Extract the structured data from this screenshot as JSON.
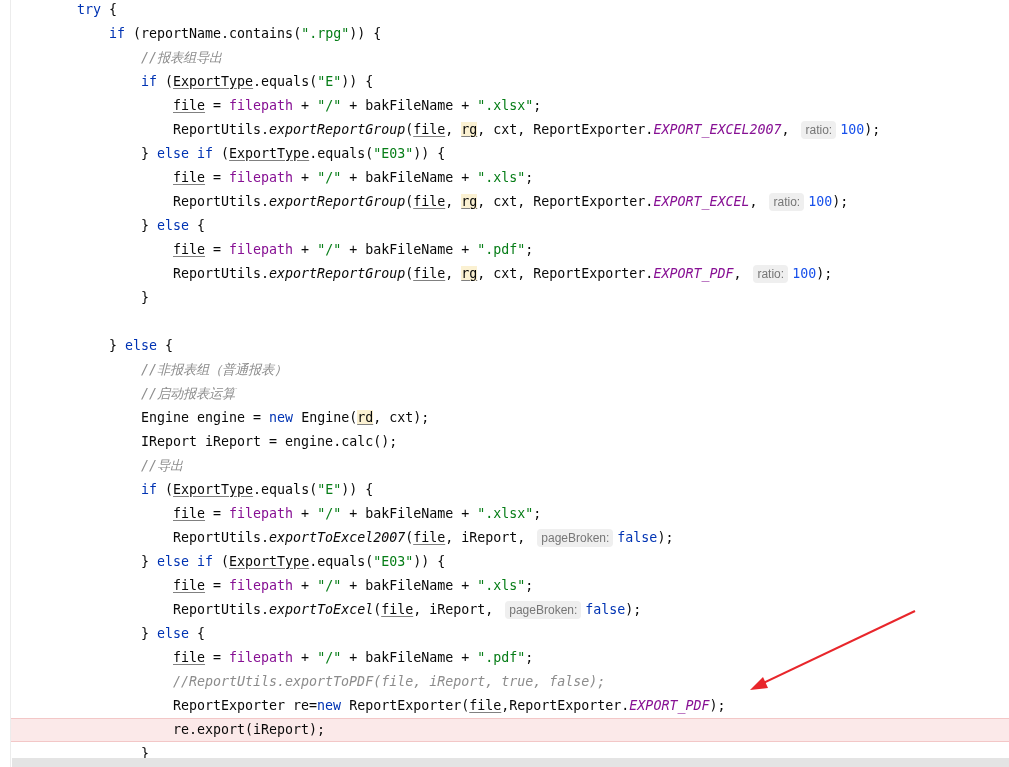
{
  "editor": {
    "lines": [
      {
        "tokens": [
          {
            "kind": "keyword",
            "text": "try"
          },
          {
            "kind": "plain",
            "text": " {"
          }
        ],
        "children": [
          {
            "tokens": [
              {
                "kind": "keyword",
                "text": "if"
              },
              {
                "kind": "plain",
                "text": " (reportName.contains("
              },
              {
                "kind": "string",
                "text": "\".rpg\""
              },
              {
                "kind": "plain",
                "text": ")) {"
              }
            ],
            "children": [
              {
                "tokens": [
                  {
                    "kind": "comment",
                    "text": "//报表组导出"
                  }
                ]
              },
              {
                "tokens": [
                  {
                    "kind": "keyword",
                    "text": "if"
                  },
                  {
                    "kind": "plain",
                    "text": " ("
                  },
                  {
                    "kind": "underlined",
                    "text": "ExportType"
                  },
                  {
                    "kind": "plain",
                    "text": ".equals("
                  },
                  {
                    "kind": "string",
                    "text": "\"E\""
                  },
                  {
                    "kind": "plain",
                    "text": ")) {"
                  }
                ],
                "children": [
                  {
                    "tokens": [
                      {
                        "kind": "underlined",
                        "text": "file"
                      },
                      {
                        "kind": "plain",
                        "text": " = "
                      },
                      {
                        "kind": "field",
                        "text": "filepath"
                      },
                      {
                        "kind": "plain",
                        "text": " + "
                      },
                      {
                        "kind": "string",
                        "text": "\"/\""
                      },
                      {
                        "kind": "plain",
                        "text": " + bakFileName + "
                      },
                      {
                        "kind": "string",
                        "text": "\".xlsx\""
                      },
                      {
                        "kind": "plain",
                        "text": ";"
                      }
                    ]
                  },
                  {
                    "tokens": [
                      {
                        "kind": "plain",
                        "text": "ReportUtils."
                      },
                      {
                        "kind": "method",
                        "text": "exportReportGroup"
                      },
                      {
                        "kind": "plain",
                        "text": "("
                      },
                      {
                        "kind": "underlined",
                        "text": "file"
                      },
                      {
                        "kind": "plain",
                        "text": ", "
                      },
                      {
                        "kind": "marked",
                        "text": "rg"
                      },
                      {
                        "kind": "plain",
                        "text": ", cxt, ReportExporter."
                      },
                      {
                        "kind": "constant",
                        "text": "EXPORT_EXCEL2007"
                      },
                      {
                        "kind": "plain",
                        "text": ", "
                      },
                      {
                        "kind": "hint",
                        "text": "ratio:"
                      },
                      {
                        "kind": "number",
                        "text": "100"
                      },
                      {
                        "kind": "plain",
                        "text": ");"
                      }
                    ]
                  }
                ]
              },
              {
                "tokens": [
                  {
                    "kind": "plain",
                    "text": "} "
                  },
                  {
                    "kind": "keyword",
                    "text": "else if"
                  },
                  {
                    "kind": "plain",
                    "text": " ("
                  },
                  {
                    "kind": "underlined",
                    "text": "ExportType"
                  },
                  {
                    "kind": "plain",
                    "text": ".equals("
                  },
                  {
                    "kind": "string",
                    "text": "\"E03\""
                  },
                  {
                    "kind": "plain",
                    "text": ")) {"
                  }
                ],
                "children": [
                  {
                    "tokens": [
                      {
                        "kind": "underlined",
                        "text": "file"
                      },
                      {
                        "kind": "plain",
                        "text": " = "
                      },
                      {
                        "kind": "field",
                        "text": "filepath"
                      },
                      {
                        "kind": "plain",
                        "text": " + "
                      },
                      {
                        "kind": "string",
                        "text": "\"/\""
                      },
                      {
                        "kind": "plain",
                        "text": " + bakFileName + "
                      },
                      {
                        "kind": "string",
                        "text": "\".xls\""
                      },
                      {
                        "kind": "plain",
                        "text": ";"
                      }
                    ]
                  },
                  {
                    "tokens": [
                      {
                        "kind": "plain",
                        "text": "ReportUtils."
                      },
                      {
                        "kind": "method",
                        "text": "exportReportGroup"
                      },
                      {
                        "kind": "plain",
                        "text": "("
                      },
                      {
                        "kind": "underlined",
                        "text": "file"
                      },
                      {
                        "kind": "plain",
                        "text": ", "
                      },
                      {
                        "kind": "marked",
                        "text": "rg"
                      },
                      {
                        "kind": "plain",
                        "text": ", cxt, ReportExporter."
                      },
                      {
                        "kind": "constant",
                        "text": "EXPORT_EXCEL"
                      },
                      {
                        "kind": "plain",
                        "text": ", "
                      },
                      {
                        "kind": "hint",
                        "text": "ratio:"
                      },
                      {
                        "kind": "number",
                        "text": "100"
                      },
                      {
                        "kind": "plain",
                        "text": ");"
                      }
                    ]
                  }
                ]
              },
              {
                "tokens": [
                  {
                    "kind": "plain",
                    "text": "} "
                  },
                  {
                    "kind": "keyword",
                    "text": "else"
                  },
                  {
                    "kind": "plain",
                    "text": " {"
                  }
                ],
                "children": [
                  {
                    "tokens": [
                      {
                        "kind": "underlined",
                        "text": "file"
                      },
                      {
                        "kind": "plain",
                        "text": " = "
                      },
                      {
                        "kind": "field",
                        "text": "filepath"
                      },
                      {
                        "kind": "plain",
                        "text": " + "
                      },
                      {
                        "kind": "string",
                        "text": "\"/\""
                      },
                      {
                        "kind": "plain",
                        "text": " + bakFileName + "
                      },
                      {
                        "kind": "string",
                        "text": "\".pdf\""
                      },
                      {
                        "kind": "plain",
                        "text": ";"
                      }
                    ]
                  },
                  {
                    "tokens": [
                      {
                        "kind": "plain",
                        "text": "ReportUtils."
                      },
                      {
                        "kind": "method",
                        "text": "exportReportGroup"
                      },
                      {
                        "kind": "plain",
                        "text": "("
                      },
                      {
                        "kind": "underlined",
                        "text": "file"
                      },
                      {
                        "kind": "plain",
                        "text": ", "
                      },
                      {
                        "kind": "marked",
                        "text": "rg"
                      },
                      {
                        "kind": "plain",
                        "text": ", cxt, ReportExporter."
                      },
                      {
                        "kind": "constant",
                        "text": "EXPORT_PDF"
                      },
                      {
                        "kind": "plain",
                        "text": ", "
                      },
                      {
                        "kind": "hint",
                        "text": "ratio:"
                      },
                      {
                        "kind": "number",
                        "text": "100"
                      },
                      {
                        "kind": "plain",
                        "text": ");"
                      }
                    ]
                  }
                ]
              },
              {
                "tokens": [
                  {
                    "kind": "plain",
                    "text": "}"
                  }
                ],
                "blank_line_after": true
              }
            ]
          },
          {
            "tokens": [
              {
                "kind": "plain",
                "text": "} "
              },
              {
                "kind": "keyword",
                "text": "else"
              },
              {
                "kind": "plain",
                "text": " {"
              }
            ],
            "children": [
              {
                "tokens": [
                  {
                    "kind": "comment",
                    "text": "//非报表组（普通报表）"
                  }
                ]
              },
              {
                "tokens": [
                  {
                    "kind": "comment",
                    "text": "//启动报表运算"
                  }
                ]
              },
              {
                "tokens": [
                  {
                    "kind": "plain",
                    "text": "Engine engine = "
                  },
                  {
                    "kind": "keyword",
                    "text": "new"
                  },
                  {
                    "kind": "plain",
                    "text": " Engine("
                  },
                  {
                    "kind": "marked",
                    "text": "rd"
                  },
                  {
                    "kind": "plain",
                    "text": ", cxt);"
                  }
                ]
              },
              {
                "tokens": [
                  {
                    "kind": "plain",
                    "text": "IReport iReport = engine.calc();"
                  }
                ]
              },
              {
                "tokens": [
                  {
                    "kind": "comment",
                    "text": "//导出"
                  }
                ]
              },
              {
                "tokens": [
                  {
                    "kind": "keyword",
                    "text": "if"
                  },
                  {
                    "kind": "plain",
                    "text": " ("
                  },
                  {
                    "kind": "underlined",
                    "text": "ExportType"
                  },
                  {
                    "kind": "plain",
                    "text": ".equals("
                  },
                  {
                    "kind": "string",
                    "text": "\"E\""
                  },
                  {
                    "kind": "plain",
                    "text": ")) {"
                  }
                ],
                "children": [
                  {
                    "tokens": [
                      {
                        "kind": "underlined",
                        "text": "file"
                      },
                      {
                        "kind": "plain",
                        "text": " = "
                      },
                      {
                        "kind": "field",
                        "text": "filepath"
                      },
                      {
                        "kind": "plain",
                        "text": " + "
                      },
                      {
                        "kind": "string",
                        "text": "\"/\""
                      },
                      {
                        "kind": "plain",
                        "text": " + bakFileName + "
                      },
                      {
                        "kind": "string",
                        "text": "\".xlsx\""
                      },
                      {
                        "kind": "plain",
                        "text": ";"
                      }
                    ]
                  },
                  {
                    "tokens": [
                      {
                        "kind": "plain",
                        "text": "ReportUtils."
                      },
                      {
                        "kind": "method",
                        "text": "exportToExcel2007"
                      },
                      {
                        "kind": "plain",
                        "text": "("
                      },
                      {
                        "kind": "underlined",
                        "text": "file"
                      },
                      {
                        "kind": "plain",
                        "text": ", iReport, "
                      },
                      {
                        "kind": "hint",
                        "text": "pageBroken:"
                      },
                      {
                        "kind": "keyword",
                        "text": "false"
                      },
                      {
                        "kind": "plain",
                        "text": ");"
                      }
                    ]
                  }
                ]
              },
              {
                "tokens": [
                  {
                    "kind": "plain",
                    "text": "} "
                  },
                  {
                    "kind": "keyword",
                    "text": "else if"
                  },
                  {
                    "kind": "plain",
                    "text": " ("
                  },
                  {
                    "kind": "underlined",
                    "text": "ExportType"
                  },
                  {
                    "kind": "plain",
                    "text": ".equals("
                  },
                  {
                    "kind": "string",
                    "text": "\"E03\""
                  },
                  {
                    "kind": "plain",
                    "text": ")) {"
                  }
                ],
                "children": [
                  {
                    "tokens": [
                      {
                        "kind": "underlined",
                        "text": "file"
                      },
                      {
                        "kind": "plain",
                        "text": " = "
                      },
                      {
                        "kind": "field",
                        "text": "filepath"
                      },
                      {
                        "kind": "plain",
                        "text": " + "
                      },
                      {
                        "kind": "string",
                        "text": "\"/\""
                      },
                      {
                        "kind": "plain",
                        "text": " + bakFileName + "
                      },
                      {
                        "kind": "string",
                        "text": "\".xls\""
                      },
                      {
                        "kind": "plain",
                        "text": ";"
                      }
                    ]
                  },
                  {
                    "tokens": [
                      {
                        "kind": "plain",
                        "text": "ReportUtils."
                      },
                      {
                        "kind": "method",
                        "text": "exportToExcel"
                      },
                      {
                        "kind": "plain",
                        "text": "("
                      },
                      {
                        "kind": "underlined",
                        "text": "file"
                      },
                      {
                        "kind": "plain",
                        "text": ", iReport, "
                      },
                      {
                        "kind": "hint",
                        "text": "pageBroken:"
                      },
                      {
                        "kind": "keyword",
                        "text": "false"
                      },
                      {
                        "kind": "plain",
                        "text": ");"
                      }
                    ]
                  }
                ]
              },
              {
                "tokens": [
                  {
                    "kind": "plain",
                    "text": "} "
                  },
                  {
                    "kind": "keyword",
                    "text": "else"
                  },
                  {
                    "kind": "plain",
                    "text": " {"
                  }
                ],
                "children": [
                  {
                    "tokens": [
                      {
                        "kind": "underlined",
                        "text": "file"
                      },
                      {
                        "kind": "plain",
                        "text": " = "
                      },
                      {
                        "kind": "field",
                        "text": "filepath"
                      },
                      {
                        "kind": "plain",
                        "text": " + "
                      },
                      {
                        "kind": "string",
                        "text": "\"/\""
                      },
                      {
                        "kind": "plain",
                        "text": " + bakFileName + "
                      },
                      {
                        "kind": "string",
                        "text": "\".pdf\""
                      },
                      {
                        "kind": "plain",
                        "text": ";"
                      }
                    ]
                  },
                  {
                    "tokens": [
                      {
                        "kind": "comment",
                        "text": "//ReportUtils.exportToPDF(file, iReport, true, false);"
                      }
                    ]
                  },
                  {
                    "tokens": [
                      {
                        "kind": "plain",
                        "text": "ReportExporter re="
                      },
                      {
                        "kind": "keyword",
                        "text": "new"
                      },
                      {
                        "kind": "plain",
                        "text": " ReportExporter("
                      },
                      {
                        "kind": "underlined",
                        "text": "file"
                      },
                      {
                        "kind": "plain",
                        "text": ",ReportExporter."
                      },
                      {
                        "kind": "constant",
                        "text": "EXPORT_PDF"
                      },
                      {
                        "kind": "plain",
                        "text": ");"
                      }
                    ]
                  },
                  {
                    "highlighted": true,
                    "tokens": [
                      {
                        "kind": "plain",
                        "text": "re.export(iReport);"
                      }
                    ]
                  }
                ]
              },
              {
                "tokens": [
                  {
                    "kind": "plain",
                    "text": "}"
                  }
                ]
              }
            ]
          }
        ]
      }
    ]
  }
}
